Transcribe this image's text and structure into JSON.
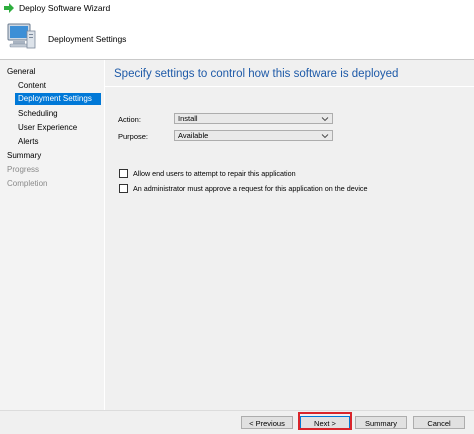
{
  "window": {
    "title": "Deploy Software Wizard",
    "app_icon": "green-arrow-icon"
  },
  "header": {
    "title": "Deployment Settings",
    "icon": "computer-icon"
  },
  "nav": {
    "items": [
      {
        "label": "General",
        "state": "normal"
      },
      {
        "label": "Content",
        "state": "normal"
      },
      {
        "label": "Deployment Settings",
        "state": "selected"
      },
      {
        "label": "Scheduling",
        "state": "normal"
      },
      {
        "label": "User Experience",
        "state": "normal"
      },
      {
        "label": "Alerts",
        "state": "normal"
      },
      {
        "label": "Summary",
        "state": "normal"
      },
      {
        "label": "Progress",
        "state": "disabled"
      },
      {
        "label": "Completion",
        "state": "disabled"
      }
    ]
  },
  "main": {
    "heading": "Specify settings to control how this software is deployed",
    "action": {
      "label": "Action:",
      "value": "Install"
    },
    "purpose": {
      "label": "Purpose:",
      "value": "Available"
    },
    "checkboxes": [
      {
        "label": "Allow end users to attempt to repair this application",
        "checked": false
      },
      {
        "label": "An administrator must approve a request for this application on the device",
        "checked": false
      }
    ]
  },
  "footer": {
    "previous_label": "< Previous",
    "next_label": "Next >",
    "summary_label": "Summary",
    "cancel_label": "Cancel"
  },
  "colors": {
    "accent": "#0078d7",
    "heading": "#1e5aa8",
    "highlight": "#d9252b"
  }
}
